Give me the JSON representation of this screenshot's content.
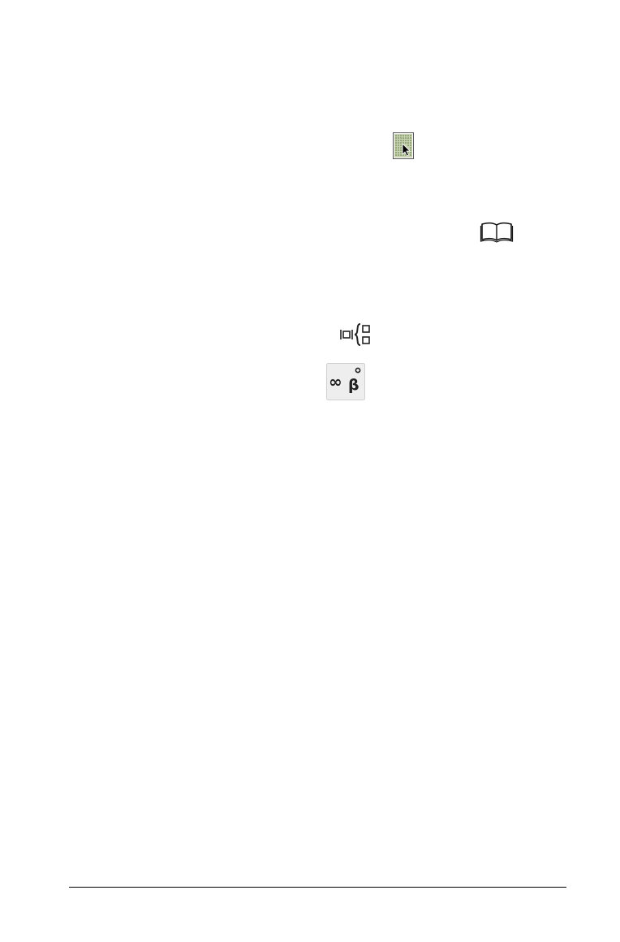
{
  "icons": [
    {
      "name": "catalog-icon",
      "semantic": "page-select-grid-with-cursor-icon"
    },
    {
      "name": "book-icon",
      "semantic": "open-book-library-icon"
    },
    {
      "name": "templates-icon",
      "semantic": "math-templates-icon"
    },
    {
      "name": "symbols-icon",
      "semantic": "infinity-beta-symbols-icon"
    }
  ],
  "colors": {
    "page_background": "#ffffff",
    "footer_rule": "#000000",
    "catalog_fill": "#b8c6a2",
    "catalog_dots": "#6f8a50",
    "symbols_background": "#eeeeee"
  }
}
